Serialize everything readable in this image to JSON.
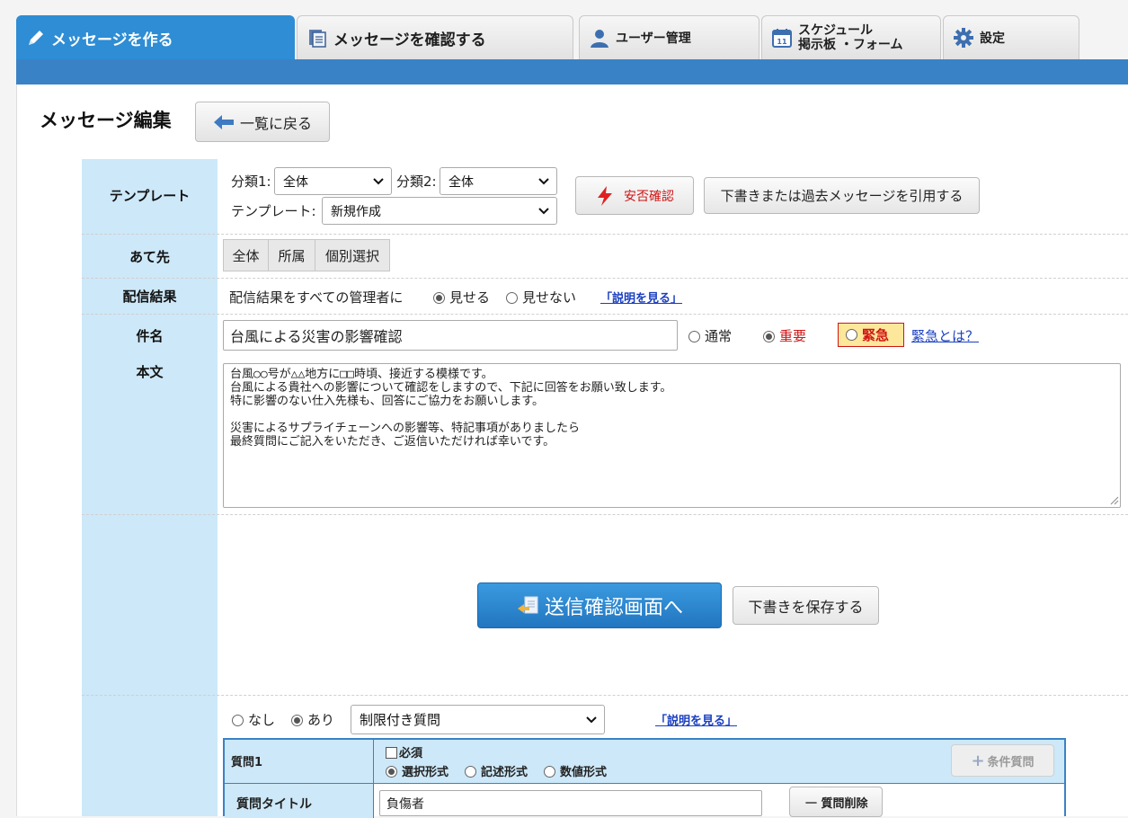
{
  "tabs": {
    "create": "メッセージを作る",
    "confirm": "メッセージを確認する",
    "users": "ユーザー管理",
    "schedule_line1": "スケジュール",
    "schedule_line2": "掲示板 ・フォーム",
    "settings": "設定"
  },
  "header": {
    "title": "メッセージ編集",
    "back_label": "一覧に戻る"
  },
  "labels": {
    "template": "テンプレート",
    "destination": "あて先",
    "delivery_result": "配信結果",
    "subject": "件名",
    "body": "本文"
  },
  "template": {
    "cat1_label": "分類1:",
    "cat1_value": "全体",
    "cat2_label": "分類2:",
    "cat2_value": "全体",
    "tpl_label": "テンプレート:",
    "tpl_value": "新規作成",
    "safety_label": "安否確認",
    "quote_label": "下書きまたは過去メッセージを引用する"
  },
  "destination": {
    "all": "全体",
    "affiliation": "所属",
    "individual": "個別選択"
  },
  "delivery": {
    "text": "配信結果をすべての管理者に",
    "show": "見せる",
    "hide": "見せない",
    "explain": "「説明を見る」",
    "selected": "show"
  },
  "subject": {
    "value": "台風による災害の影響確認",
    "normal": "通常",
    "important": "重要",
    "urgent": "緊急",
    "what_urgent": "緊急とは？",
    "selected": "important"
  },
  "body": {
    "lines": [
      "台風○○号が△△地方に□□時頃、接近する模様です。",
      "台風による貴社への影響について確認をしますので、下記に回答をお願い致します。",
      "特に影響のない仕入先様も、回答にご協力をお願いします。",
      "",
      "災害によるサプライチェーンへの影響等、特記事項がありましたら",
      "最終質問にご記入をいただき、ご返信いただければ幸いです。"
    ]
  },
  "actions": {
    "send_confirm": "送信確認画面へ",
    "save_draft": "下書きを保存する"
  },
  "question": {
    "none": "なし",
    "exists": "あり",
    "selected": "exists",
    "type_value": "制限付き質問",
    "explain": "「説明を見る」",
    "q1_label": "質問1",
    "required": "必須",
    "format_choice": "選択形式",
    "format_text": "記述形式",
    "format_number": "数値形式",
    "selected_format": "choice",
    "conditional_btn": "条件質問",
    "title_label": "質問タイトル",
    "title_value": "負傷者",
    "delete_btn": "質問削除"
  },
  "colors": {
    "accent": "#3a82c6",
    "tab_active": "#2e8dd4",
    "label_bg": "#cde8f8",
    "important_red": "#d01515"
  }
}
